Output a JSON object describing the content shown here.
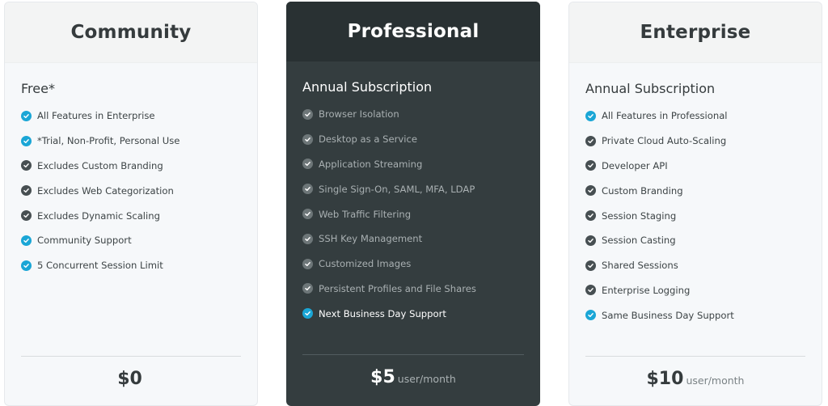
{
  "plans": [
    {
      "title": "Community",
      "subtitle": "Free*",
      "features": [
        {
          "label": "All Features in Enterprise",
          "icon": "check-circle-icon",
          "color": "#1aa6d6"
        },
        {
          "label": "*Trial, Non-Profit, Personal Use",
          "icon": "check-circle-icon",
          "color": "#1aa6d6"
        },
        {
          "label": "Excludes Custom Branding",
          "icon": "check-circle-icon",
          "color": "#474f52"
        },
        {
          "label": "Excludes Web Categorization",
          "icon": "check-circle-icon",
          "color": "#474f52"
        },
        {
          "label": "Excludes Dynamic Scaling",
          "icon": "check-circle-icon",
          "color": "#474f52"
        },
        {
          "label": "Community Support",
          "icon": "check-circle-icon",
          "color": "#1aa6d6"
        },
        {
          "label": "5 Concurrent Session Limit",
          "icon": "check-circle-icon",
          "color": "#1aa6d6"
        }
      ],
      "price": "$0",
      "price_unit": ""
    },
    {
      "title": "Professional",
      "subtitle": "Annual Subscription",
      "features": [
        {
          "label": "Browser Isolation",
          "icon": "check-circle-icon",
          "color": "#6d7678"
        },
        {
          "label": "Desktop as a Service",
          "icon": "check-circle-icon",
          "color": "#6d7678"
        },
        {
          "label": "Application Streaming",
          "icon": "check-circle-icon",
          "color": "#6d7678"
        },
        {
          "label": "Single Sign-On, SAML, MFA, LDAP",
          "icon": "check-circle-icon",
          "color": "#6d7678"
        },
        {
          "label": "Web Traffic Filtering",
          "icon": "check-circle-icon",
          "color": "#6d7678"
        },
        {
          "label": "SSH Key Management",
          "icon": "check-circle-icon",
          "color": "#6d7678"
        },
        {
          "label": "Customized Images",
          "icon": "check-circle-icon",
          "color": "#6d7678"
        },
        {
          "label": "Persistent Profiles and File Shares",
          "icon": "check-circle-icon",
          "color": "#6d7678"
        },
        {
          "label": "Next Business Day Support",
          "icon": "check-circle-icon",
          "color": "#1aa6d6"
        }
      ],
      "price": "$5",
      "price_unit": "user/month"
    },
    {
      "title": "Enterprise",
      "subtitle": "Annual Subscription",
      "features": [
        {
          "label": "All Features in Professional",
          "icon": "check-circle-icon",
          "color": "#1aa6d6"
        },
        {
          "label": "Private Cloud Auto-Scaling",
          "icon": "check-circle-icon",
          "color": "#474f52"
        },
        {
          "label": "Developer API",
          "icon": "check-circle-icon",
          "color": "#474f52"
        },
        {
          "label": "Custom Branding",
          "icon": "check-circle-icon",
          "color": "#474f52"
        },
        {
          "label": "Session Staging",
          "icon": "check-circle-icon",
          "color": "#474f52"
        },
        {
          "label": "Session Casting",
          "icon": "check-circle-icon",
          "color": "#474f52"
        },
        {
          "label": "Shared Sessions",
          "icon": "check-circle-icon",
          "color": "#474f52"
        },
        {
          "label": "Enterprise Logging",
          "icon": "check-circle-icon",
          "color": "#474f52"
        },
        {
          "label": "Same Business Day Support",
          "icon": "check-circle-icon",
          "color": "#1aa6d6"
        }
      ],
      "price": "$10",
      "price_unit": "user/month"
    }
  ]
}
